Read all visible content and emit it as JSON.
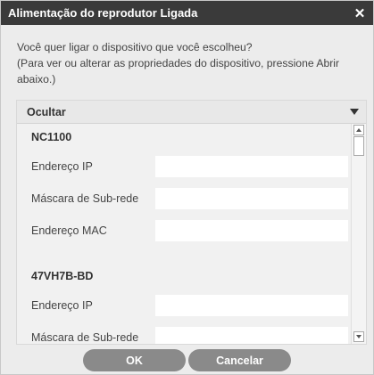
{
  "dialog": {
    "title": "Alimentação do reprodutor Ligada",
    "close_glyph": "✕",
    "message_line1": "Você quer ligar o dispositivo que você escolheu?",
    "message_line2": "(Para ver ou alterar as propriedades do dispositivo, pressione Abrir abaixo.)"
  },
  "panel": {
    "header_label": "Ocultar",
    "devices": [
      {
        "name": "NC1100",
        "fields": [
          {
            "label": "Endereço IP",
            "value": ""
          },
          {
            "label": "Máscara de Sub-rede",
            "value": ""
          },
          {
            "label": "Endereço MAC",
            "value": ""
          }
        ]
      },
      {
        "name": "47VH7B-BD",
        "fields": [
          {
            "label": "Endereço IP",
            "value": ""
          },
          {
            "label": "Máscara de Sub-rede",
            "value": ""
          }
        ]
      }
    ]
  },
  "buttons": {
    "ok_label": "OK",
    "cancel_label": "Cancelar"
  },
  "icons": {
    "close": "close-icon",
    "collapse": "chevron-down-icon",
    "scroll_up": "scroll-up-icon",
    "scroll_down": "scroll-down-icon"
  },
  "colors": {
    "titlebar": "#3a3a3a",
    "button": "#8a8a8a",
    "background": "#ececec"
  }
}
